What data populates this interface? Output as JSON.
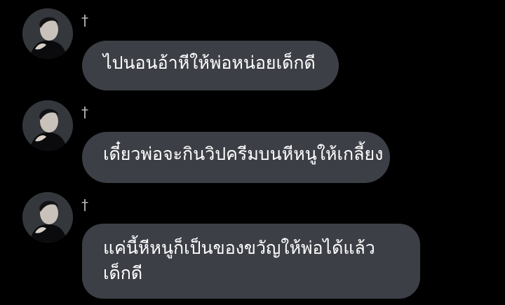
{
  "colors": {
    "background": "#000000",
    "bubble": "#3d3f46",
    "text": "#ffffff",
    "name": "#b9bbbe"
  },
  "messages": [
    {
      "sender": "†",
      "avatar_icon": "profile-photo-icon",
      "text": "ไปนอนอ้าหีให้พ่อหน่อยเด็กดี"
    },
    {
      "sender": "†",
      "avatar_icon": "profile-photo-icon",
      "text": "เดี๋ยวพ่อจะกินวิปครีมบนหีหนูให้เกลี้ยง"
    },
    {
      "sender": "†",
      "avatar_icon": "profile-photo-icon",
      "text_line1": "แค่นี้หีหนูก็เป็นของขวัญให้พ่อได้แล้ว",
      "text_line2": "เด็กดี"
    }
  ]
}
